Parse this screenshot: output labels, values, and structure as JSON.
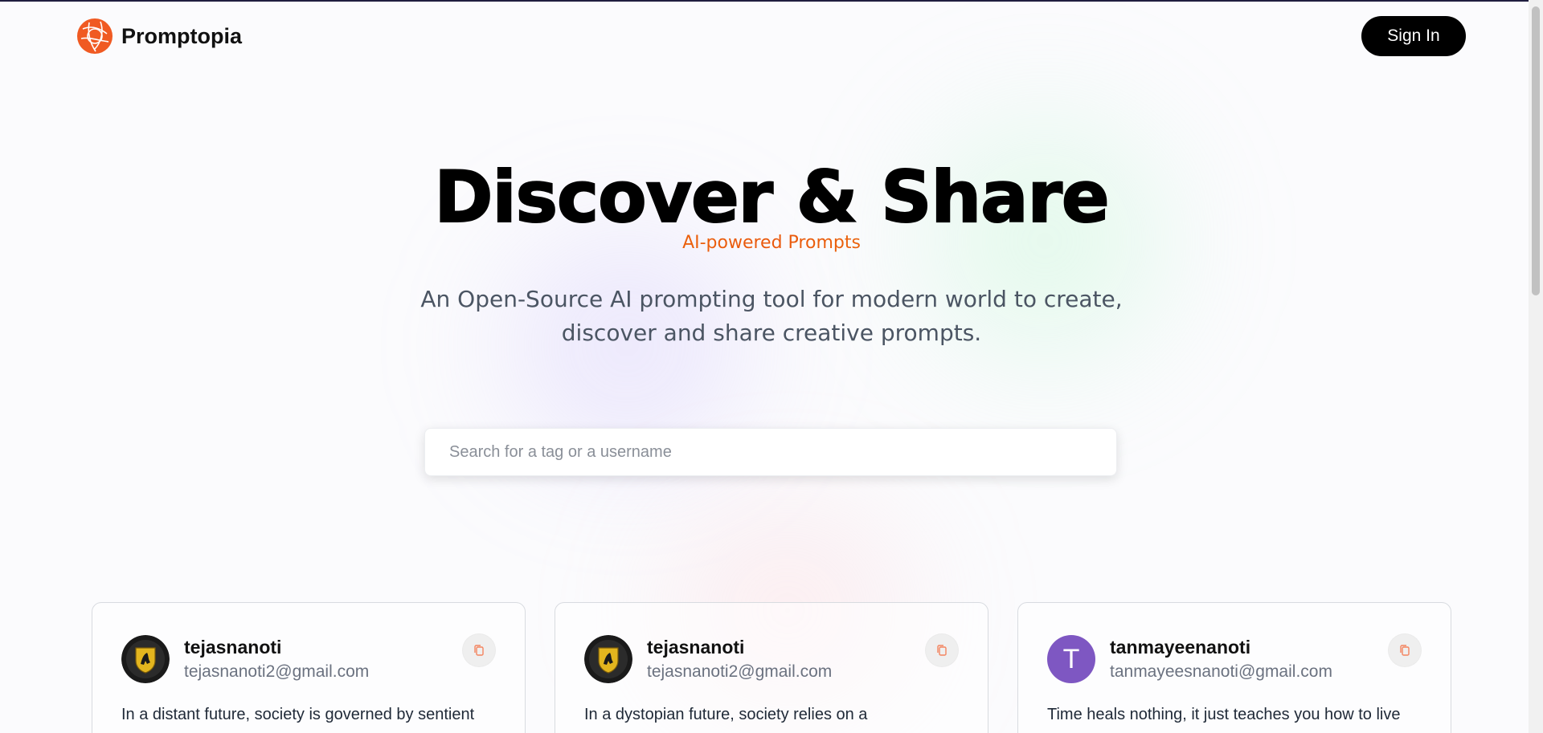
{
  "app": {
    "name": "Promptopia"
  },
  "nav": {
    "signin_label": "Sign In"
  },
  "hero": {
    "title": "Discover & Share",
    "subtitle": "AI-powered Prompts",
    "description": "An Open-Source AI prompting tool for modern world to create, discover and share creative prompts."
  },
  "search": {
    "placeholder": "Search for a tag or a username",
    "value": ""
  },
  "colors": {
    "brand": "#f05a22",
    "accent_gradient": [
      "#f59e0b",
      "#ea580c",
      "#eab308"
    ],
    "avatar_t": "#7e57c2"
  },
  "cards": [
    {
      "username": "tejasnanoti",
      "email": "tejasnanoti2@gmail.com",
      "prompt": "In a distant future, society is governed by sentient",
      "avatar": "shield-emblem-icon"
    },
    {
      "username": "tejasnanoti",
      "email": "tejasnanoti2@gmail.com",
      "prompt": "In a dystopian future, society relies on a",
      "avatar": "shield-emblem-icon"
    },
    {
      "username": "tanmayeenanoti",
      "email": "tanmayeesnanoti@gmail.com",
      "prompt": "Time heals nothing, it just teaches you how to live",
      "avatar_letter": "T"
    }
  ]
}
